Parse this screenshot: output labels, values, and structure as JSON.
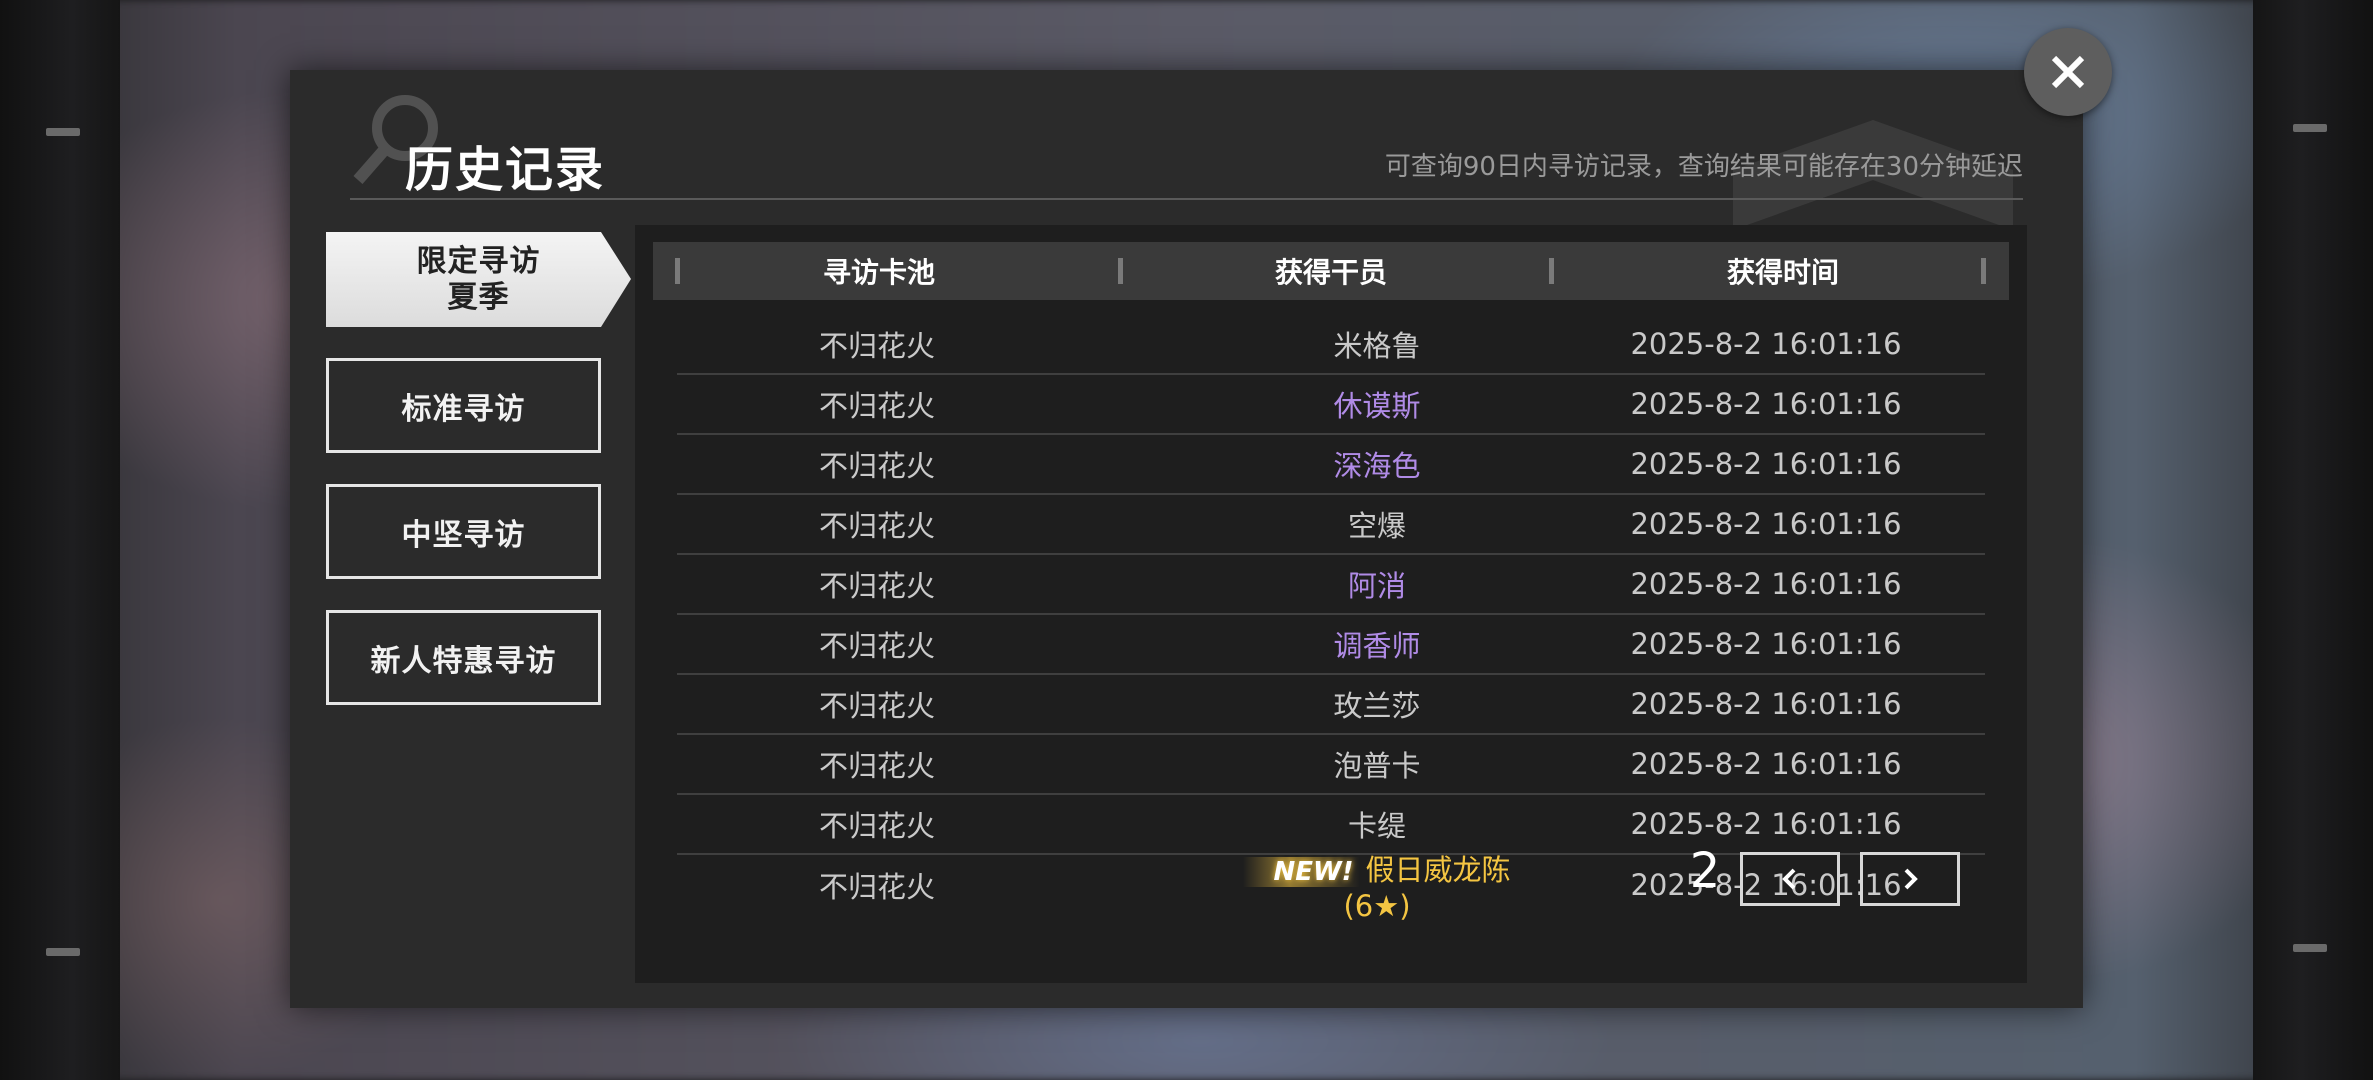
{
  "dialog": {
    "title": "历史记录",
    "hint": "可查询90日内寻访记录，查询结果可能存在30分钟延迟",
    "close_icon": "close-icon"
  },
  "tabs": [
    {
      "line1": "限定寻访",
      "line2": "夏季",
      "active": true
    },
    {
      "label": "标准寻访",
      "active": false
    },
    {
      "label": "中坚寻访",
      "active": false
    },
    {
      "label": "新人特惠寻访",
      "active": false
    }
  ],
  "table": {
    "headers": [
      "寻访卡池",
      "获得干员",
      "获得时间"
    ],
    "rows": [
      {
        "pool": "不归花火",
        "operator": "米格鲁",
        "rarity": "normal",
        "time": "2025-8-2 16:01:16"
      },
      {
        "pool": "不归花火",
        "operator": "休谟斯",
        "rarity": "rare",
        "time": "2025-8-2 16:01:16"
      },
      {
        "pool": "不归花火",
        "operator": "深海色",
        "rarity": "rare",
        "time": "2025-8-2 16:01:16"
      },
      {
        "pool": "不归花火",
        "operator": "空爆",
        "rarity": "normal",
        "time": "2025-8-2 16:01:16"
      },
      {
        "pool": "不归花火",
        "operator": "阿消",
        "rarity": "rare",
        "time": "2025-8-2 16:01:16"
      },
      {
        "pool": "不归花火",
        "operator": "调香师",
        "rarity": "rare",
        "time": "2025-8-2 16:01:16"
      },
      {
        "pool": "不归花火",
        "operator": "玫兰莎",
        "rarity": "normal",
        "time": "2025-8-2 16:01:16"
      },
      {
        "pool": "不归花火",
        "operator": "泡普卡",
        "rarity": "normal",
        "time": "2025-8-2 16:01:16"
      },
      {
        "pool": "不归花火",
        "operator": "卡缇",
        "rarity": "normal",
        "time": "2025-8-2 16:01:16"
      },
      {
        "pool": "不归花火",
        "operator": "假日威龙陈 (6★)",
        "rarity": "top",
        "badge": "NEW!",
        "time": "2025-8-2 16:01:16"
      }
    ]
  },
  "pager": {
    "page": "2",
    "prev_icon": "chevron-left-icon",
    "next_icon": "chevron-right-icon"
  },
  "colors": {
    "rare": "#b08be6",
    "top": "#f4c542",
    "normal": "#c9c9c9"
  }
}
